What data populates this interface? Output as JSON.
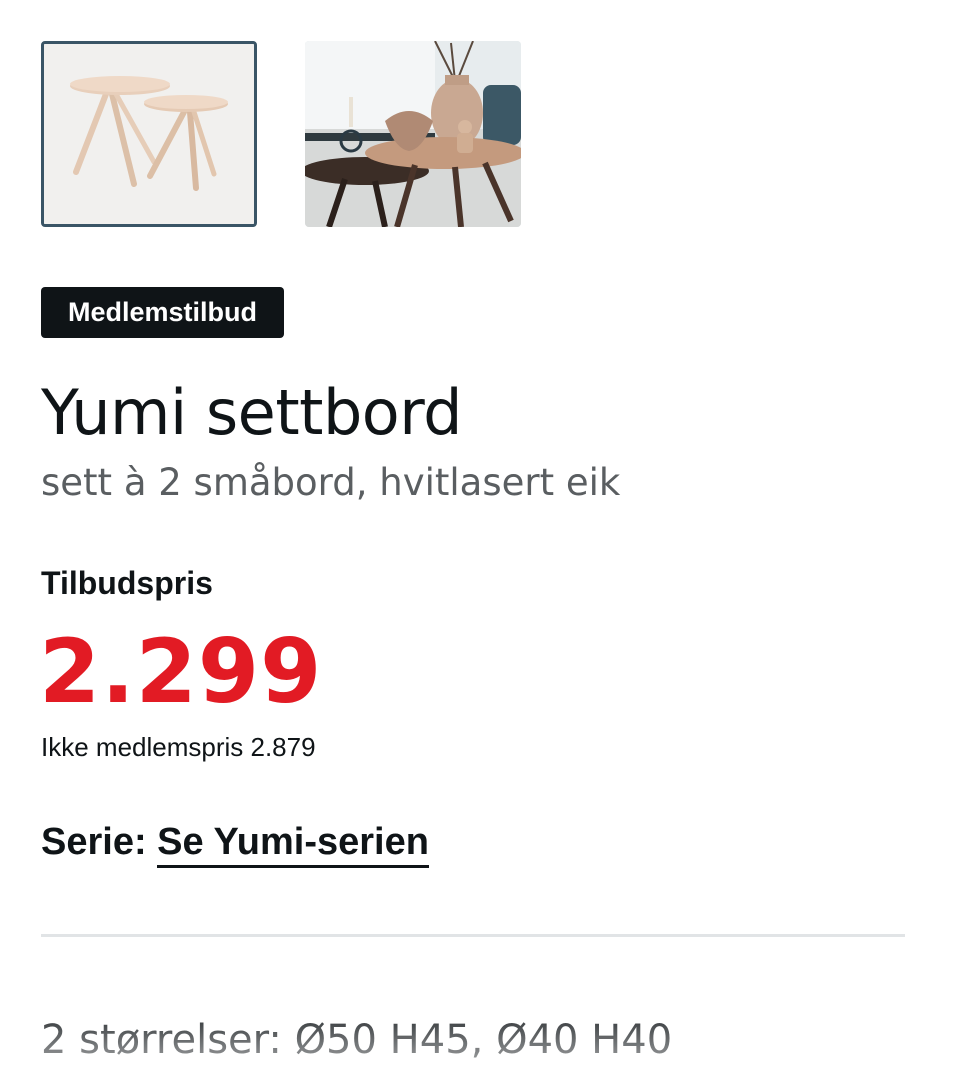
{
  "gallery": {
    "thumbnails": [
      {
        "name": "product-image-tables",
        "selected": true
      },
      {
        "name": "lifestyle-image-tables",
        "selected": false
      }
    ]
  },
  "badge": {
    "label": "Medlemstilbud"
  },
  "product": {
    "title": "Yumi settbord",
    "subtitle": "sett à 2 småbord, hvitlasert eik"
  },
  "pricing": {
    "offer_label": "Tilbudspris",
    "price": "2.299",
    "non_member_text": "Ikke medlemspris 2.879",
    "price_color": "#e21b24"
  },
  "series": {
    "label": "Serie:",
    "link_text": "Se Yumi-serien"
  },
  "details": {
    "sizes_text": "2 størrelser: Ø50 H45, Ø40 H40"
  },
  "colors": {
    "text": "#0f1417",
    "muted": "#5a5e61",
    "accent_red": "#e21b24",
    "selected_border": "#3a5566",
    "divider": "#e1e4e6"
  }
}
